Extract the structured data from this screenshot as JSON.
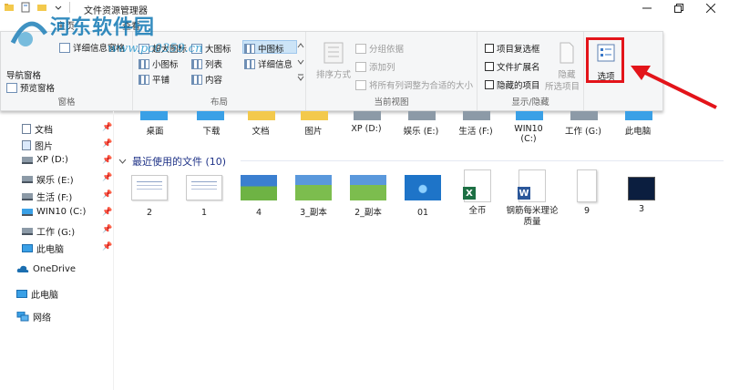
{
  "window": {
    "title": "文件资源管理器"
  },
  "tabs": [
    {
      "label": "主页"
    },
    {
      "label": "查看"
    }
  ],
  "watermark": {
    "title": "河东软件园",
    "url": "www.pc0359.cn"
  },
  "ribbon": {
    "panes": {
      "nav_pane": "导航窗格",
      "preview_pane": "预览窗格",
      "details_pane": "详细信息窗格",
      "label": "窗格"
    },
    "layout": {
      "xl_icons": "超大图标",
      "large_icons": "大图标",
      "medium_icons": "中图标",
      "small_icons": "小图标",
      "list": "列表",
      "details": "详细信息",
      "tiles": "平铺",
      "content": "内容",
      "label": "布局"
    },
    "current_view": {
      "sort_by": "排序方式",
      "group_by": "分组依据",
      "add_columns": "添加列",
      "size_all_columns": "将所有列调整为合适的大小",
      "label": "当前视图"
    },
    "show_hide": {
      "item_checkboxes": "项目复选框",
      "file_name_extensions": "文件扩展名",
      "hidden_items": "隐藏的项目",
      "hide": "隐藏",
      "selected_items": "所选项目",
      "label": "显示/隐藏"
    },
    "options": {
      "label": "选项"
    }
  },
  "nav": {
    "items": [
      {
        "label": "文档",
        "icon": "document-icon",
        "pinned": true
      },
      {
        "label": "图片",
        "icon": "pictures-icon",
        "pinned": true
      },
      {
        "label": "XP (D:)",
        "icon": "drive-icon",
        "pinned": true
      },
      {
        "label": "娱乐 (E:)",
        "icon": "drive-icon",
        "pinned": true
      },
      {
        "label": "生活 (F:)",
        "icon": "drive-icon",
        "pinned": true
      },
      {
        "label": "WIN10 (C:)",
        "icon": "drive-icon",
        "pinned": true
      },
      {
        "label": "工作 (G:)",
        "icon": "drive-icon",
        "pinned": true
      },
      {
        "label": "此电脑",
        "icon": "computer-icon",
        "pinned": true
      }
    ],
    "onedrive": "OneDrive",
    "this_pc": "此电脑",
    "network": "网络",
    "pin_glyph": "📌"
  },
  "pinned_folders": [
    "桌面",
    "下载",
    "文档",
    "图片",
    "XP (D:)",
    "娱乐 (E:)",
    "生活 (F:)",
    "WIN10\n(C:)",
    "工作 (G:)",
    "此电脑"
  ],
  "recent": {
    "header": "最近使用的文件 (10)",
    "files": [
      {
        "name": "2",
        "kind": "doc-white"
      },
      {
        "name": "1",
        "kind": "doc-white"
      },
      {
        "name": "4",
        "kind": "land"
      },
      {
        "name": "3_副本",
        "kind": "land2"
      },
      {
        "name": "2_副本",
        "kind": "land2"
      },
      {
        "name": "01",
        "kind": "w7"
      },
      {
        "name": "全币",
        "kind": "excel"
      },
      {
        "name": "钢筋每米理论质量",
        "kind": "word"
      },
      {
        "name": "9",
        "kind": "paper"
      },
      {
        "name": "3",
        "kind": "dark"
      }
    ]
  },
  "colors": {
    "accent": "#1e3287",
    "highlight_box": "#e3141a",
    "selection": "#cce4f7"
  }
}
